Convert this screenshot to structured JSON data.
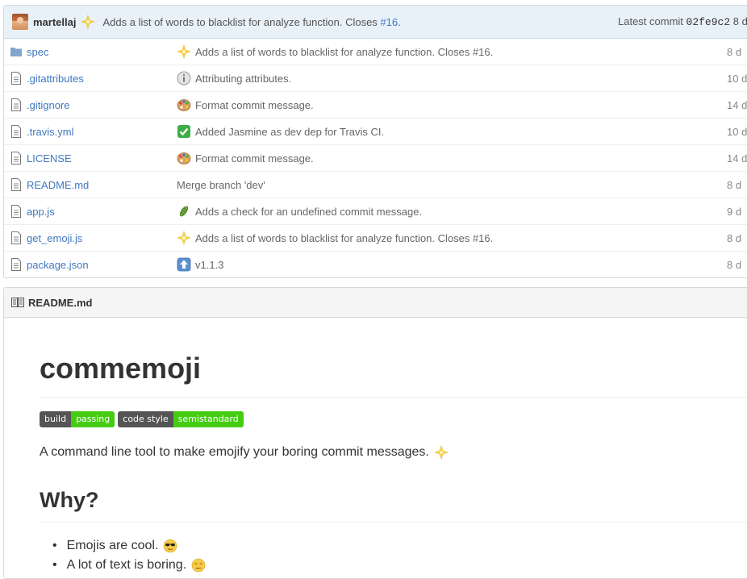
{
  "commit_bar": {
    "author": "martellaj",
    "message": "Adds a list of words to blacklist for analyze function. Closes ",
    "issue_link": "#16",
    "issue_suffix": ".",
    "latest_label": "Latest commit ",
    "sha": "02fe9c2",
    "age": " 8 d"
  },
  "files": [
    {
      "name": "spec",
      "type": "folder",
      "emoji": "sparkle",
      "message": "Adds a list of words to blacklist for analyze function. Closes #16.",
      "age": "8 d"
    },
    {
      "name": ".gitattributes",
      "type": "file",
      "emoji": "info",
      "message": "Attributing attributes.",
      "age": "10 d"
    },
    {
      "name": ".gitignore",
      "type": "file",
      "emoji": "palette",
      "message": "Format commit message.",
      "age": "14 d"
    },
    {
      "name": ".travis.yml",
      "type": "file",
      "emoji": "check",
      "message": "Added Jasmine as dev dep for Travis CI.",
      "age": "10 d"
    },
    {
      "name": "LICENSE",
      "type": "file",
      "emoji": "palette",
      "message": "Format commit message.",
      "age": "14 d"
    },
    {
      "name": "README.md",
      "type": "file",
      "emoji": "",
      "message": "Merge branch 'dev'",
      "age": "8 d"
    },
    {
      "name": "app.js",
      "type": "file",
      "emoji": "bug",
      "message": "Adds a check for an undefined commit message.",
      "age": "9 d"
    },
    {
      "name": "get_emoji.js",
      "type": "file",
      "emoji": "sparkle",
      "message": "Adds a list of words to blacklist for analyze function. Closes #16.",
      "age": "8 d"
    },
    {
      "name": "package.json",
      "type": "file",
      "emoji": "up",
      "message": "v1.1.3",
      "age": "8 d"
    }
  ],
  "readme": {
    "header": "README.md",
    "title": "commemoji",
    "badges": [
      {
        "left": "build",
        "right": "passing"
      },
      {
        "left": "code style",
        "right": "semistandard"
      }
    ],
    "tagline": "A command line tool to make emojify your boring commit messages.",
    "why_heading": "Why?",
    "bullets": [
      {
        "text": "Emojis are cool.",
        "emoji": "sunglasses"
      },
      {
        "text": "A lot of text is boring.",
        "emoji": "unamused"
      }
    ]
  },
  "colors": {
    "link": "#4078c0",
    "badge_right": "#44cc11",
    "badge_left": "#555555",
    "commit_bar_bg": "#e8f1f8"
  }
}
